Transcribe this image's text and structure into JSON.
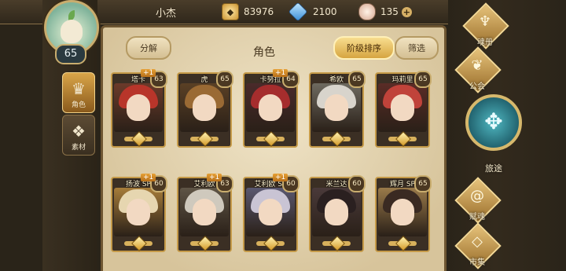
{
  "player": {
    "name": "小杰",
    "level": "65"
  },
  "resources": {
    "gold": "83976",
    "crystal": "2100",
    "shell": "135",
    "add_symbol": "+"
  },
  "left_tabs": [
    {
      "label": "角色",
      "icon": "role-icon"
    },
    {
      "label": "素材",
      "icon": "material-icon"
    }
  ],
  "panel": {
    "title": "角色",
    "decompose_label": "分解",
    "sort_label": "阶级排序",
    "filter_label": "筛选"
  },
  "heroes": [
    {
      "name": "塔卡",
      "level": "63",
      "plus": "+1",
      "hair": "#b8352a",
      "bg": "#6b3a2a"
    },
    {
      "name": "虎",
      "level": "65",
      "plus": "",
      "hair": "#9a6a34",
      "bg": "#5a4025"
    },
    {
      "name": "卡努拉",
      "level": "64",
      "plus": "+1",
      "hair": "#a52d2d",
      "bg": "#4a2a2a"
    },
    {
      "name": "希欧",
      "level": "65",
      "plus": "",
      "hair": "#d8d4cc",
      "bg": "#6e6a60"
    },
    {
      "name": "玛莉里",
      "level": "65",
      "plus": "",
      "hair": "#c0433a",
      "bg": "#5a2c26"
    },
    {
      "name": "扬波 SP",
      "level": "60",
      "plus": "+1",
      "hair": "#e6d6b0",
      "bg": "#a67c3a"
    },
    {
      "name": "艾利欧",
      "level": "63",
      "plus": "+1",
      "hair": "#cfc9bd",
      "bg": "#5f5546"
    },
    {
      "name": "艾利欧 SP",
      "level": "60",
      "plus": "+1",
      "hair": "#c9c4d4",
      "bg": "#5a5870"
    },
    {
      "name": "米兰达",
      "level": "60",
      "plus": "",
      "hair": "#2a2020",
      "bg": "#4a3a3a"
    },
    {
      "name": "辉月 SP",
      "level": "65",
      "plus": "",
      "hair": "#3a2a22",
      "bg": "#9a7a4a"
    }
  ],
  "right_menu": {
    "book": "魂册",
    "guild": "公会",
    "journey": "旅途",
    "grant": "赋魂",
    "market": "市集"
  }
}
